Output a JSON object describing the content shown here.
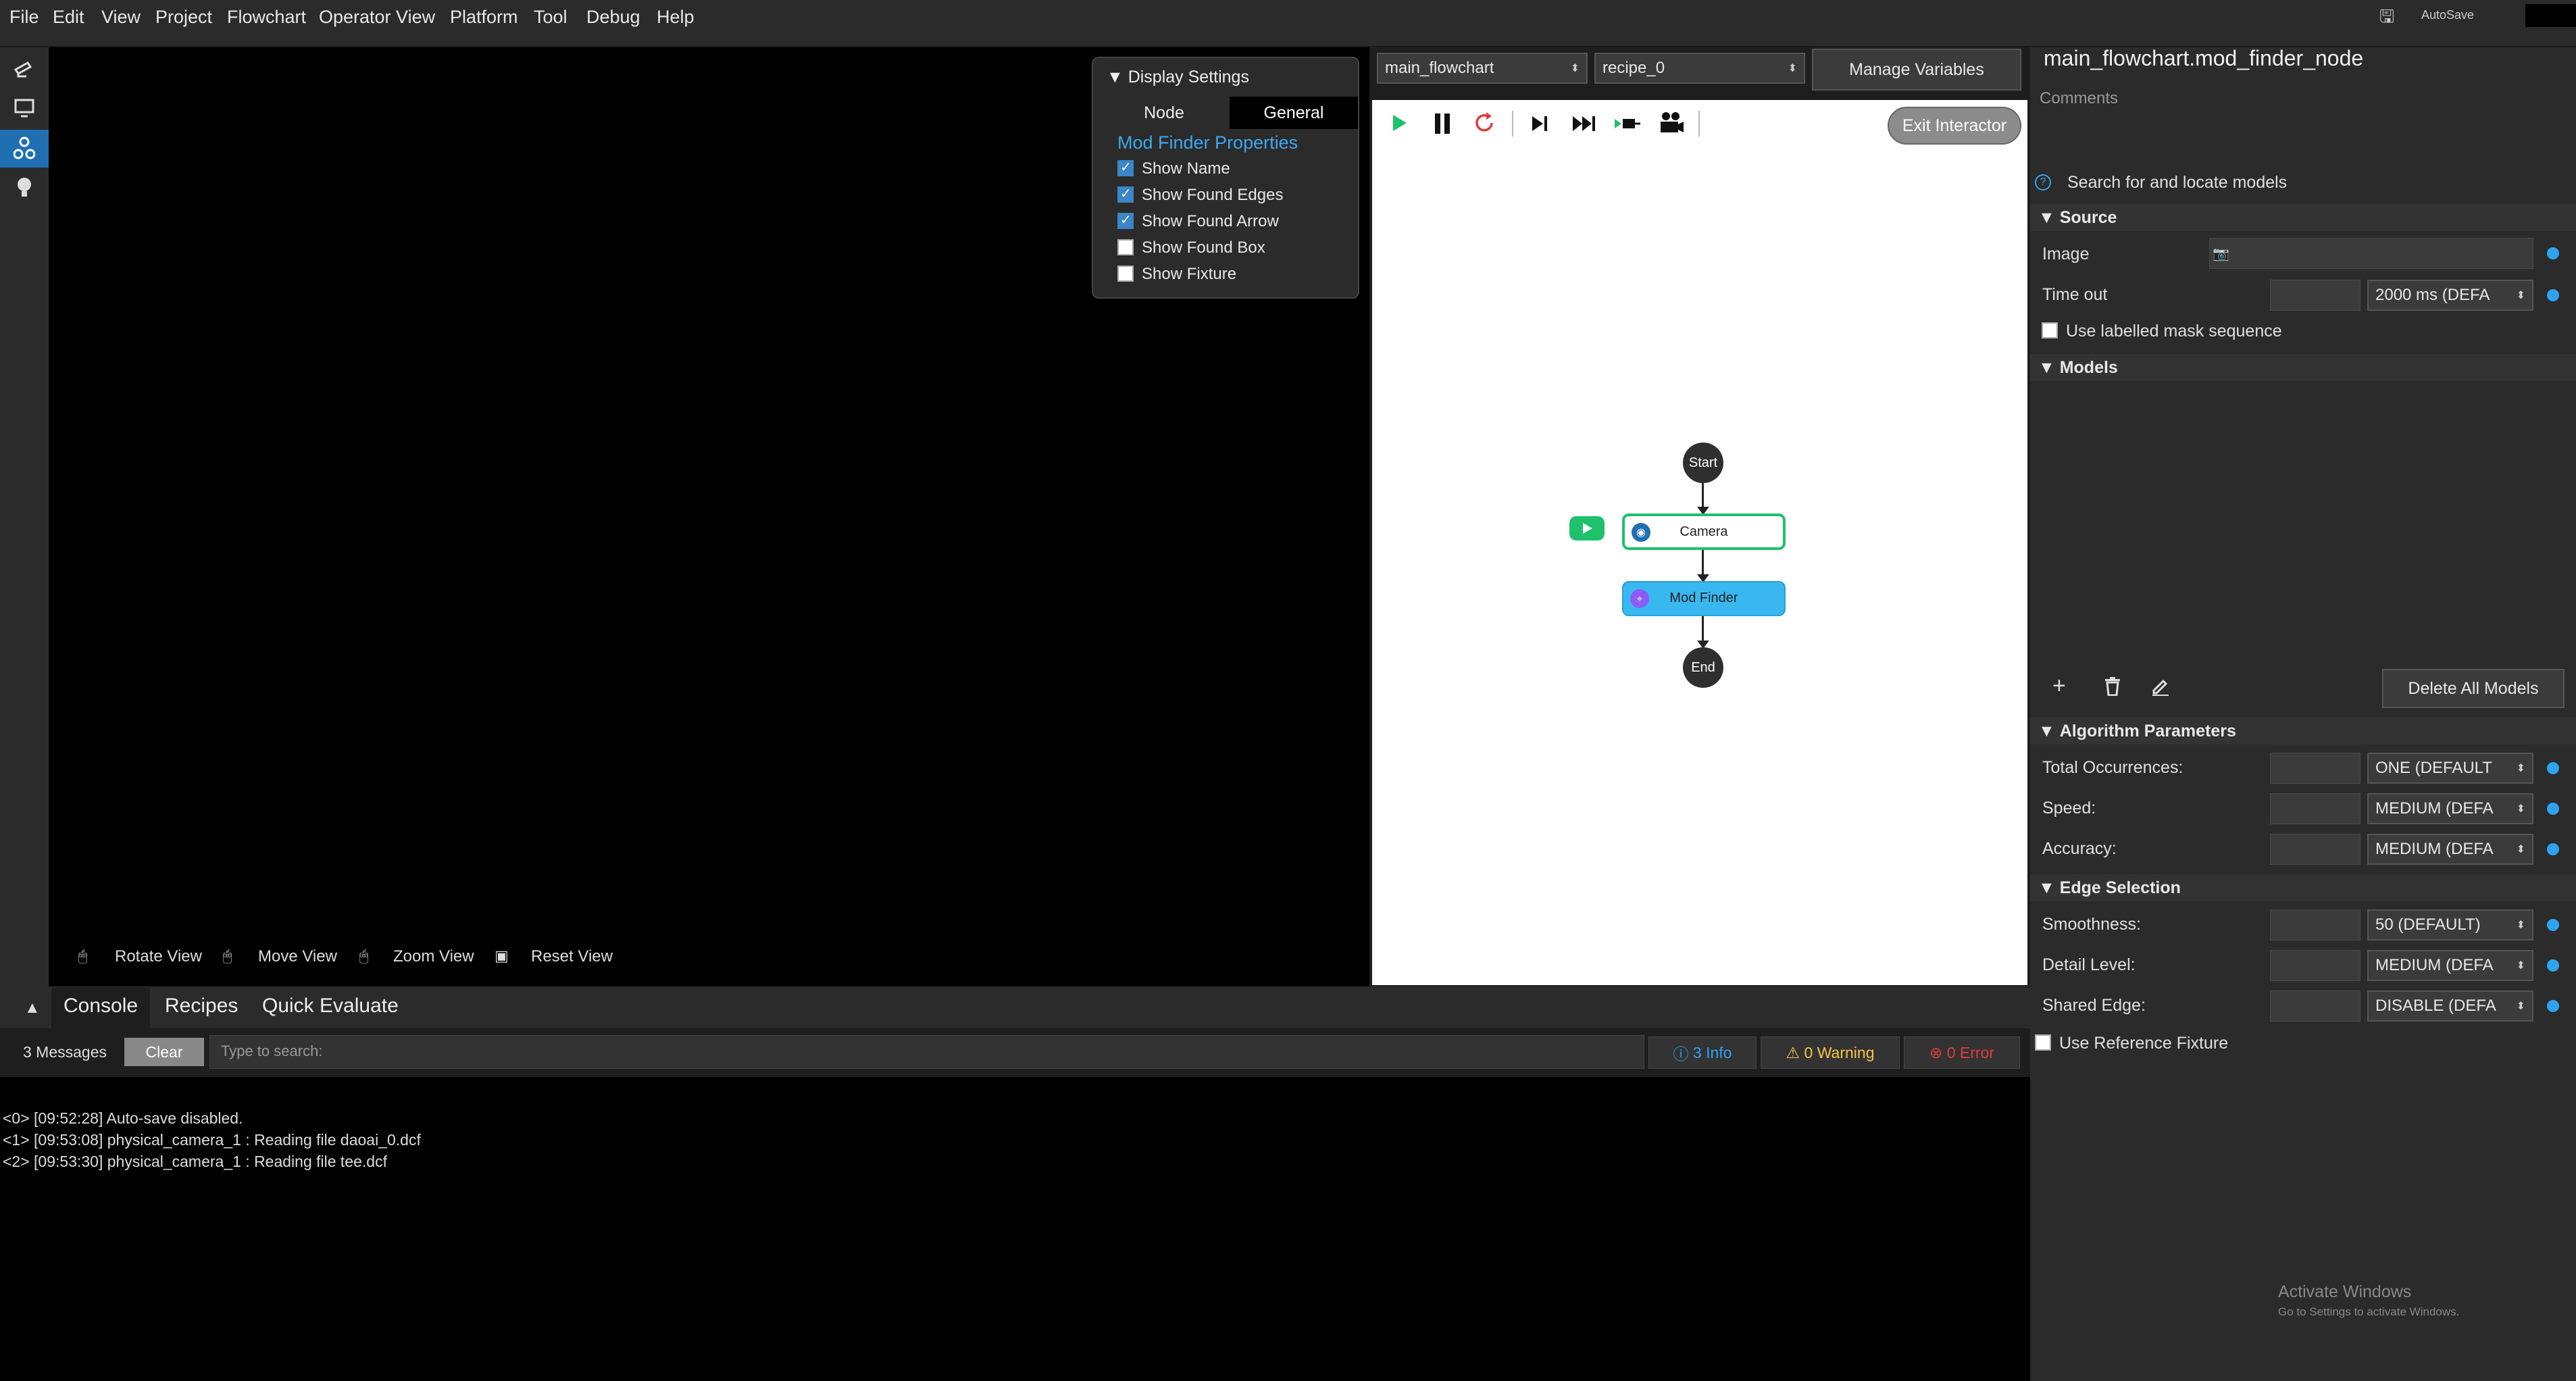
{
  "menu": [
    "File",
    "Edit",
    "View",
    "Project",
    "Flowchart",
    "Operator View",
    "Platform",
    "Tool",
    "Debug",
    "Help"
  ],
  "autosave_label": "AutoSave",
  "viewport_hints": {
    "rotate": "Rotate View",
    "move": "Move View",
    "zoom": "Zoom View",
    "reset": "Reset View"
  },
  "display_settings": {
    "title": "Display Settings",
    "tabs": [
      "Node",
      "General"
    ],
    "section": "Mod Finder Properties",
    "options": [
      {
        "label": "Show Name",
        "checked": true
      },
      {
        "label": "Show Found Edges",
        "checked": true
      },
      {
        "label": "Show Found Arrow",
        "checked": true
      },
      {
        "label": "Show Found Box",
        "checked": false
      },
      {
        "label": "Show Fixture",
        "checked": false
      }
    ]
  },
  "flowchart": {
    "flowchart_select": "main_flowchart",
    "recipe_select": "recipe_0",
    "manage_variables": "Manage Variables",
    "exit_interactor": "Exit Interactor",
    "nodes": {
      "start": "Start",
      "camera": "Camera",
      "mod_finder": "Mod Finder",
      "end": "End"
    }
  },
  "right_panel": {
    "node_title": "main_flowchart.mod_finder_node",
    "comments_placeholder": "Comments",
    "description": "Search for and locate models",
    "source_header": "Source",
    "image_label": "Image",
    "timeout_label": "Time out",
    "timeout_value": "2000 ms (DEFA",
    "use_labelled_mask": "Use labelled mask sequence",
    "models_header": "Models",
    "delete_all_models": "Delete All Models",
    "algo_header": "Algorithm Parameters",
    "total_occ_label": "Total Occurrences:",
    "total_occ_value": "ONE (DEFAULT",
    "speed_label": "Speed:",
    "speed_value": "MEDIUM (DEFA",
    "accuracy_label": "Accuracy:",
    "accuracy_value": "MEDIUM (DEFA",
    "edge_header": "Edge Selection",
    "smoothness_label": "Smoothness:",
    "smoothness_value": "50 (DEFAULT)",
    "detail_label": "Detail Level:",
    "detail_value": "MEDIUM (DEFA",
    "shared_label": "Shared Edge:",
    "shared_value": "DISABLE (DEFA",
    "use_ref_fixture": "Use Reference Fixture",
    "activate_title": "Activate Windows",
    "activate_sub": "Go to Settings to activate Windows."
  },
  "console": {
    "tabs": [
      "Console",
      "Recipes",
      "Quick Evaluate"
    ],
    "messages_count": "3 Messages",
    "clear": "Clear",
    "search_placeholder": "Type to search:",
    "info": "3 Info",
    "warning": "0 Warning",
    "error": "0 Error",
    "logs": [
      "<0> [09:52:28] Auto-save disabled.",
      "<1> [09:53:08] physical_camera_1 : Reading file daoai_0.dcf",
      "<2> [09:53:30] physical_camera_1 : Reading file tee.dcf"
    ]
  },
  "colors": {
    "accent": "#2ea3f2",
    "green": "#1fc16b",
    "flow_blue": "#39b8f0"
  }
}
